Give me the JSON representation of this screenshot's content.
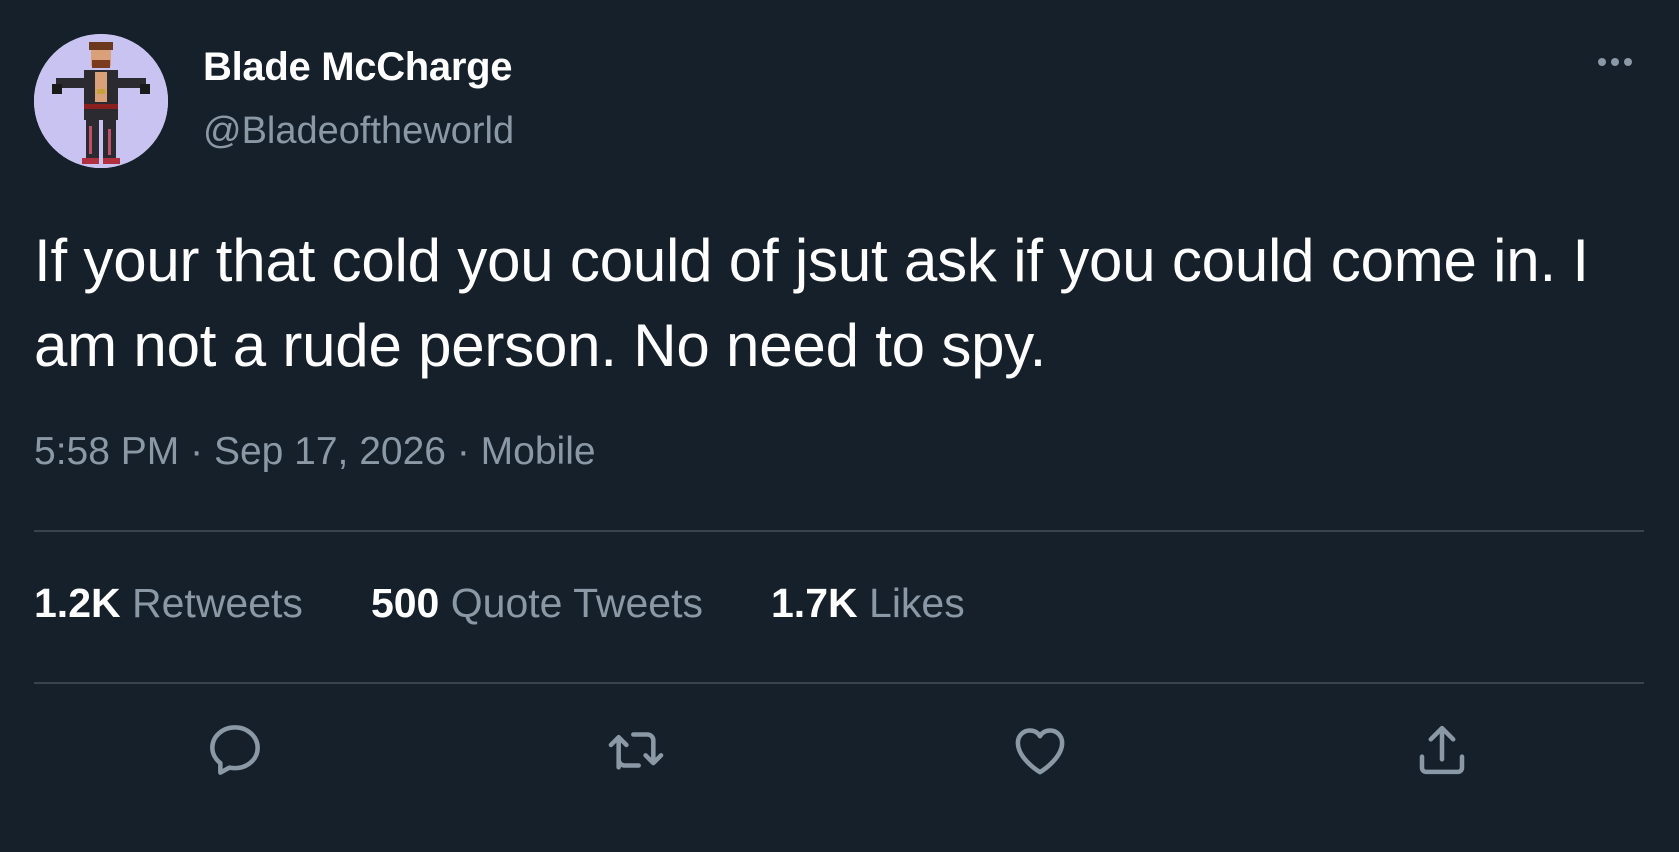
{
  "author": {
    "display_name": "Blade McCharge",
    "handle": "@Bladeoftheworld"
  },
  "tweet": {
    "text": "If your that cold you could of jsut ask if you could come in. I am not a rude person. No need to spy.",
    "time": "5:58 PM",
    "separator": "·",
    "date": "Sep 17, 2026",
    "source": "Mobile"
  },
  "stats": {
    "retweets": {
      "count": "1.2K",
      "label": "Retweets"
    },
    "quote_tweets": {
      "count": "500",
      "label": "Quote Tweets"
    },
    "likes": {
      "count": "1.7K",
      "label": "Likes"
    }
  },
  "actions": [
    "reply-icon",
    "retweet-icon",
    "like-icon",
    "share-icon"
  ],
  "colors": {
    "background": "#15202b",
    "primary_text": "#ffffff",
    "secondary_text": "#8b98a5",
    "divider": "#38444d"
  }
}
